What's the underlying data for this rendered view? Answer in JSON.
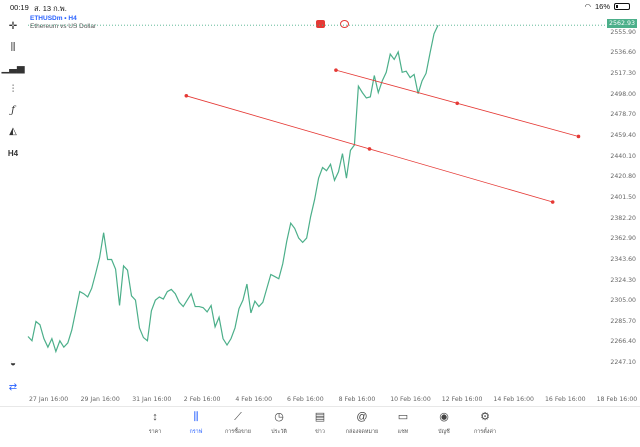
{
  "status_bar": {
    "time": "00:19",
    "date": "ส. 13 ก.พ.",
    "battery": "16%"
  },
  "chart_header": {
    "symbol": "ETHUSDm • H4",
    "description": "Ethereum vs US Dollar"
  },
  "current_price": "2562.93",
  "price_axis": [
    "2555.90",
    "2536.60",
    "2517.30",
    "2498.00",
    "2478.70",
    "2459.40",
    "2440.10",
    "2420.80",
    "2401.50",
    "2382.20",
    "2362.90",
    "2343.60",
    "2324.30",
    "2305.00",
    "2285.70",
    "2266.40",
    "2247.10"
  ],
  "time_axis": [
    "27 Jan 16:00",
    "29 Jan 16:00",
    "31 Jan 16:00",
    "2 Feb 16:00",
    "4 Feb 16:00",
    "6 Feb 16:00",
    "8 Feb 16:00",
    "10 Feb 16:00",
    "12 Feb 16:00",
    "14 Feb 16:00",
    "16 Feb 16:00",
    "18 Feb 16:00"
  ],
  "left_tools": [
    "crosshair-icon",
    "candles-icon",
    "bar-chart-icon",
    "indicators-icon",
    "function-icon",
    "objects-icon",
    "timeframe-h4"
  ],
  "timeframe_label": "H4",
  "bottom_tabs": [
    {
      "label": "ราคา",
      "icon": "↕"
    },
    {
      "label": "กราฟ",
      "icon": "⫼"
    },
    {
      "label": "การซื้อขาย",
      "icon": "⟋"
    },
    {
      "label": "ประวัติ",
      "icon": "◷"
    },
    {
      "label": "ข่าว",
      "icon": "▤"
    },
    {
      "label": "กล่องจดหมาย",
      "icon": "@"
    },
    {
      "label": "แชท",
      "icon": "▭"
    },
    {
      "label": "บัญชี",
      "icon": "◉"
    },
    {
      "label": "การตั้งค่า",
      "icon": "⚙"
    }
  ],
  "colors": {
    "line": "#4caf8a",
    "trendline": "#e53935",
    "active_tab": "#2962ff"
  },
  "chart_data": {
    "type": "line",
    "symbol": "ETHUSDm",
    "timeframe": "H4",
    "ylim": [
      2236,
      2566
    ],
    "x": [
      "27 Jan 16:00",
      "29 Jan 16:00",
      "31 Jan 16:00",
      "2 Feb 16:00",
      "4 Feb 16:00",
      "6 Feb 16:00",
      "8 Feb 16:00",
      "10 Feb 16:00",
      "12 Feb 16:00"
    ],
    "values": [
      2272,
      2268,
      2286,
      2283,
      2270,
      2262,
      2270,
      2258,
      2268,
      2262,
      2266,
      2278,
      2296,
      2314,
      2312,
      2309,
      2317,
      2331,
      2346,
      2369,
      2344,
      2344,
      2335,
      2301,
      2338,
      2334,
      2310,
      2306,
      2280,
      2271,
      2268,
      2296,
      2306,
      2309,
      2307,
      2314,
      2316,
      2312,
      2304,
      2300,
      2306,
      2312,
      2300,
      2300,
      2299,
      2295,
      2301,
      2281,
      2290,
      2270,
      2264,
      2270,
      2280,
      2298,
      2306,
      2321,
      2294,
      2305,
      2300,
      2304,
      2317,
      2330,
      2328,
      2326,
      2340,
      2361,
      2378,
      2373,
      2364,
      2360,
      2364,
      2384,
      2400,
      2420,
      2430,
      2427,
      2433,
      2418,
      2426,
      2443,
      2420,
      2446,
      2451,
      2506,
      2500,
      2495,
      2496,
      2516,
      2500,
      2511,
      2519,
      2536,
      2531,
      2538,
      2519,
      2520,
      2514,
      2517,
      2499,
      2511,
      2518,
      2537,
      2555,
      2563
    ],
    "trendlines": [
      {
        "points": [
          [
            2.7,
            2497.0
          ],
          [
            9.8,
            2397.7
          ]
        ]
      },
      {
        "points": [
          [
            5.6,
            2521.0
          ],
          [
            10.3,
            2459.0
          ]
        ]
      }
    ]
  }
}
